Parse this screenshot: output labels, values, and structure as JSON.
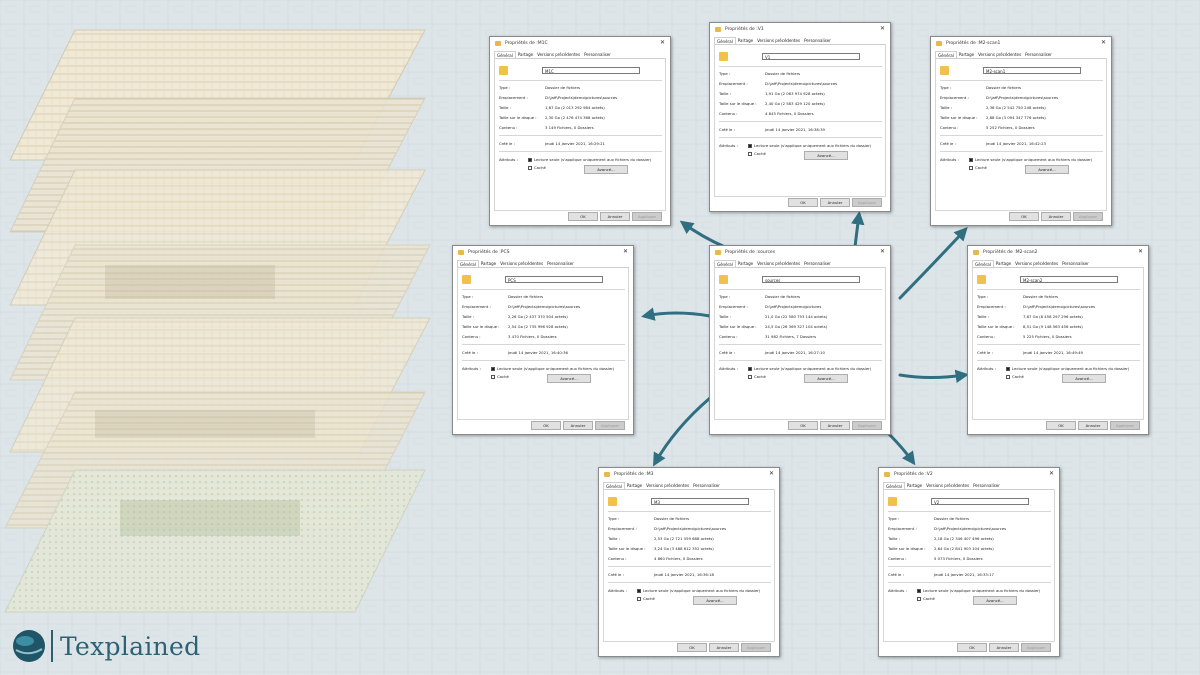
{
  "brand": {
    "name": "Texplained",
    "colors": {
      "teal": "#2f6f80",
      "background": "#dde5e9"
    }
  },
  "dialog_labels": {
    "title_prefix": "Propriétés de : ",
    "tabs": [
      "Général",
      "Partage",
      "Versions précédentes",
      "Personnaliser"
    ],
    "type_key": "Type :",
    "location_key": "Emplacement :",
    "size_key": "Taille :",
    "disk_size_key": "Taille sur le disque :",
    "contents_key": "Contenu :",
    "created_key": "Créé le :",
    "attributes_key": "Attributs :",
    "readonly_label": "Lecture seule (s'applique uniquement aux fichiers du dossier)",
    "hidden_label": "Caché",
    "advanced_button": "Avancé...",
    "ok_button": "OK",
    "cancel_button": "Annuler",
    "apply_button": "Appliquer"
  },
  "dialogs": [
    {
      "id": "m1c",
      "name": "M1C",
      "type": "Dossier de fichiers",
      "location": "D:\\jaff\\Projects\\demo\\pictures\\sources",
      "size": "1,87 Go (2 013 292 984 octets)",
      "disk_size": "2,30 Go (2 476 474 368 octets)",
      "contents": "3 149 Fichiers, 0 Dossiers",
      "created": "Jeudi 14 janvier 2021, 16:29:21"
    },
    {
      "id": "v1",
      "name": "V1",
      "type": "Dossier de fichiers",
      "location": "D:\\jaff\\Projects\\demo\\pictures\\sources",
      "size": "1,91 Go (2 063 974 928 octets)",
      "disk_size": "2,40 Go (2 583 429 120 octets)",
      "contents": "4 845 Fichiers, 0 Dossiers",
      "created": "Jeudi 14 janvier 2021, 16:38:39"
    },
    {
      "id": "m2scan1",
      "name": "M2-scan1",
      "type": "Dossier de fichiers",
      "location": "D:\\jaff\\Projects\\demo\\pictures\\sources",
      "size": "2,36 Go (2 542 750 248 octets)",
      "disk_size": "2,88 Go (3 094 347 776 octets)",
      "contents": "5 252 Fichiers, 0 Dossiers",
      "created": "Jeudi 14 janvier 2021, 16:42:23"
    },
    {
      "id": "pcs",
      "name": "PCS",
      "type": "Dossier de fichiers",
      "location": "D:\\jaff\\Projects\\demo\\pictures\\sources",
      "size": "2,26 Go (2 437 370 504 octets)",
      "disk_size": "2,54 Go (2 735 996 928 octets)",
      "contents": "3 470 Fichiers, 0 Dossiers",
      "created": "Jeudi 14 janvier 2021, 16:40:36"
    },
    {
      "id": "sources",
      "name": "sources",
      "type": "Dossier de fichiers",
      "location": "D:\\jaff\\Projects\\demo\\pictures",
      "size": "21,0 Go (22 580 753 144 octets)",
      "disk_size": "24,5 Go (26 369 327 104 octets)",
      "contents": "31 982 Fichiers, 7 Dossiers",
      "created": "Jeudi 14 janvier 2021, 16:27:10"
    },
    {
      "id": "m2scan2",
      "name": "M2-scan2",
      "type": "Dossier de fichiers",
      "location": "D:\\jaff\\Projects\\demo\\pictures\\sources",
      "size": "7,87 Go (8 458 297 296 octets)",
      "disk_size": "8,51 Go (9 148 563 456 octets)",
      "contents": "5 225 Fichiers, 0 Dossiers",
      "created": "Jeudi 14 janvier 2021, 16:49:49"
    },
    {
      "id": "m3",
      "name": "M3",
      "type": "Dossier de fichiers",
      "location": "D:\\jaff\\Projects\\demo\\pictures\\sources",
      "size": "2,53 Go (2 721 559 688 octets)",
      "disk_size": "3,24 Go (3 488 612 352 octets)",
      "contents": "4 860 Fichiers, 0 Dossiers",
      "created": "Jeudi 14 janvier 2021, 16:36:18"
    },
    {
      "id": "v2",
      "name": "V2",
      "type": "Dossier de fichiers",
      "location": "D:\\jaff\\Projects\\demo\\pictures\\sources",
      "size": "2,18 Go (2 346 407 496 octets)",
      "disk_size": "2,64 Go (2 841 903 104 octets)",
      "contents": "5 073 Fichiers, 0 Dossiers",
      "created": "Jeudi 14 janvier 2021, 16:33:17"
    }
  ]
}
